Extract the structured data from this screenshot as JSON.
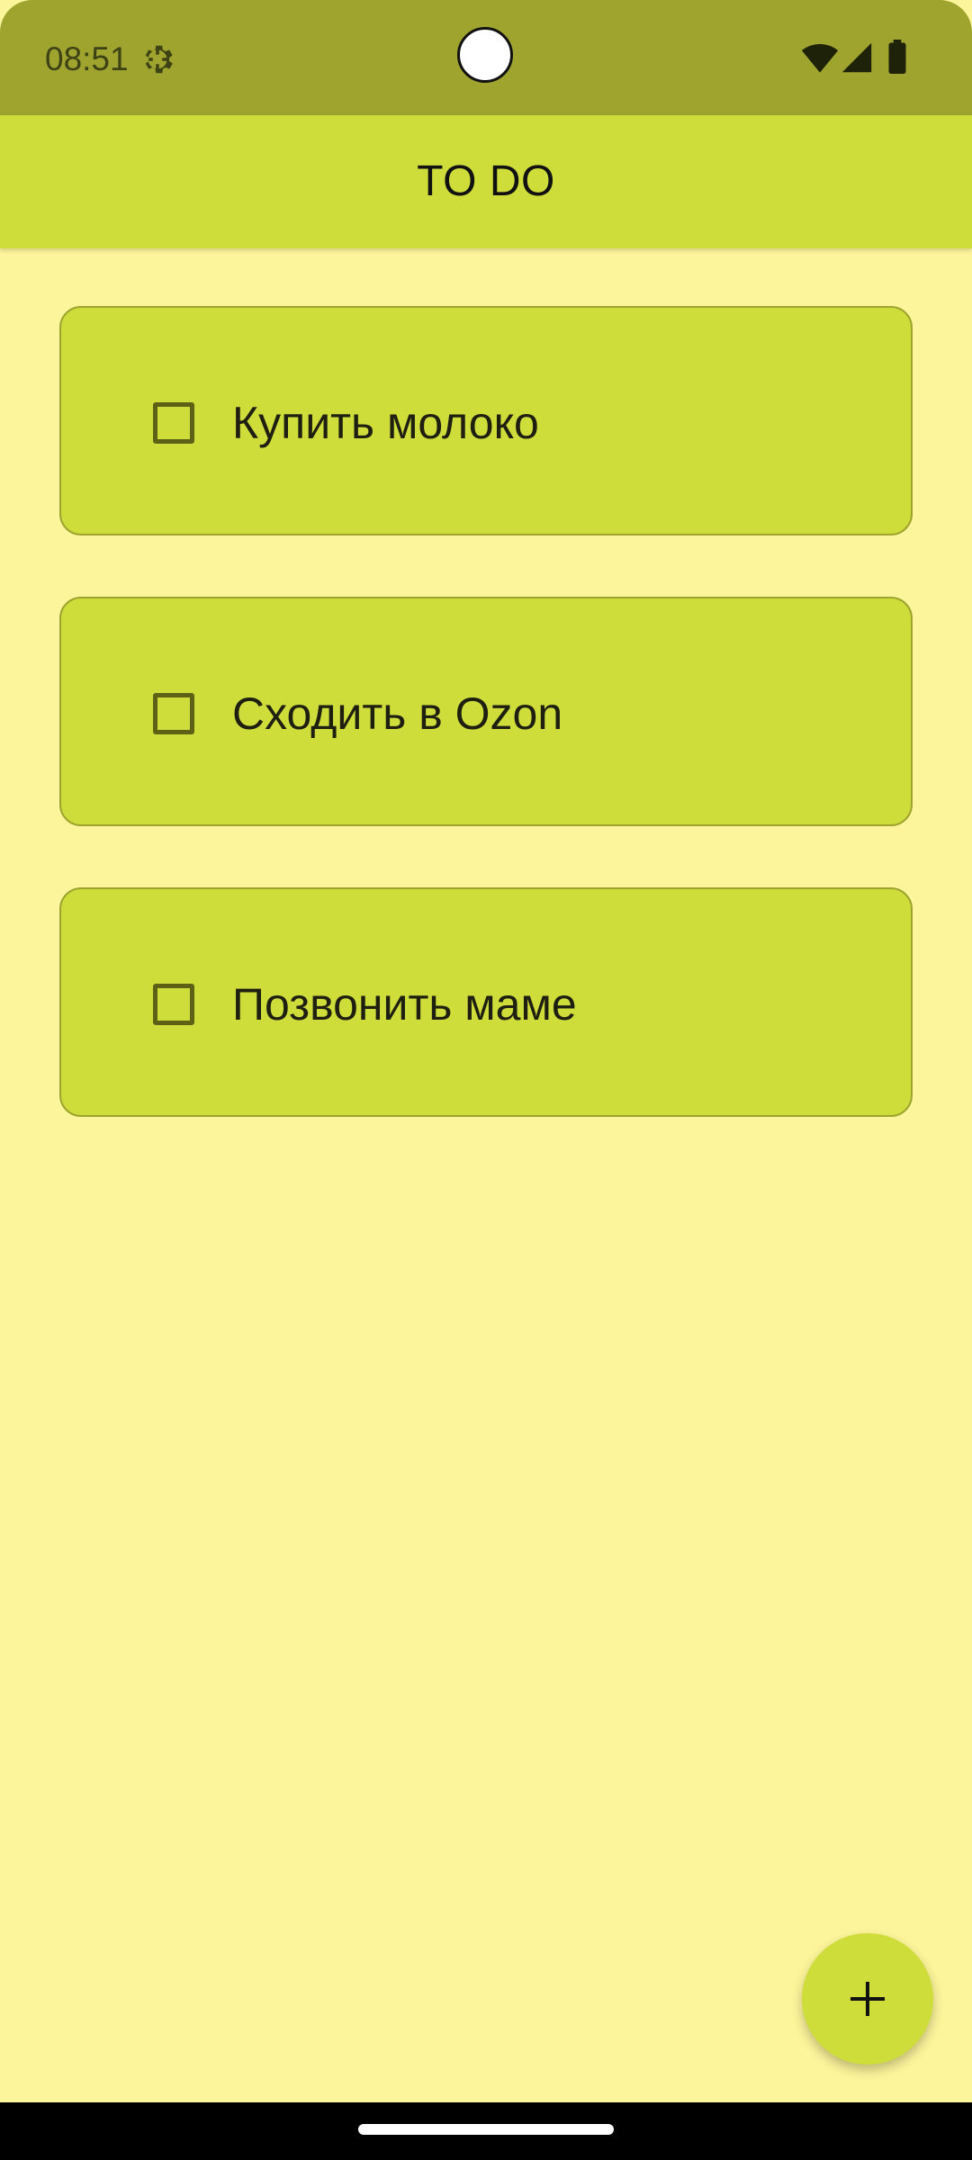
{
  "status_bar": {
    "time": "08:51",
    "icons": [
      "settings-gear-icon",
      "wifi-icon",
      "cellular-signal-icon",
      "battery-icon"
    ]
  },
  "app_bar": {
    "title": "TO DO"
  },
  "tasks": [
    {
      "label": "Купить молоко",
      "checked": false
    },
    {
      "label": "Сходить в Ozon",
      "checked": false
    },
    {
      "label": "Позвонить маме",
      "checked": false
    }
  ],
  "fab": {
    "icon": "plus-icon"
  },
  "colors": {
    "status_bar": "#9ea42e",
    "app_bar": "#cfdd3b",
    "background": "#fdf59b",
    "card": "#cfdd3b",
    "card_border": "#9ea42e"
  }
}
